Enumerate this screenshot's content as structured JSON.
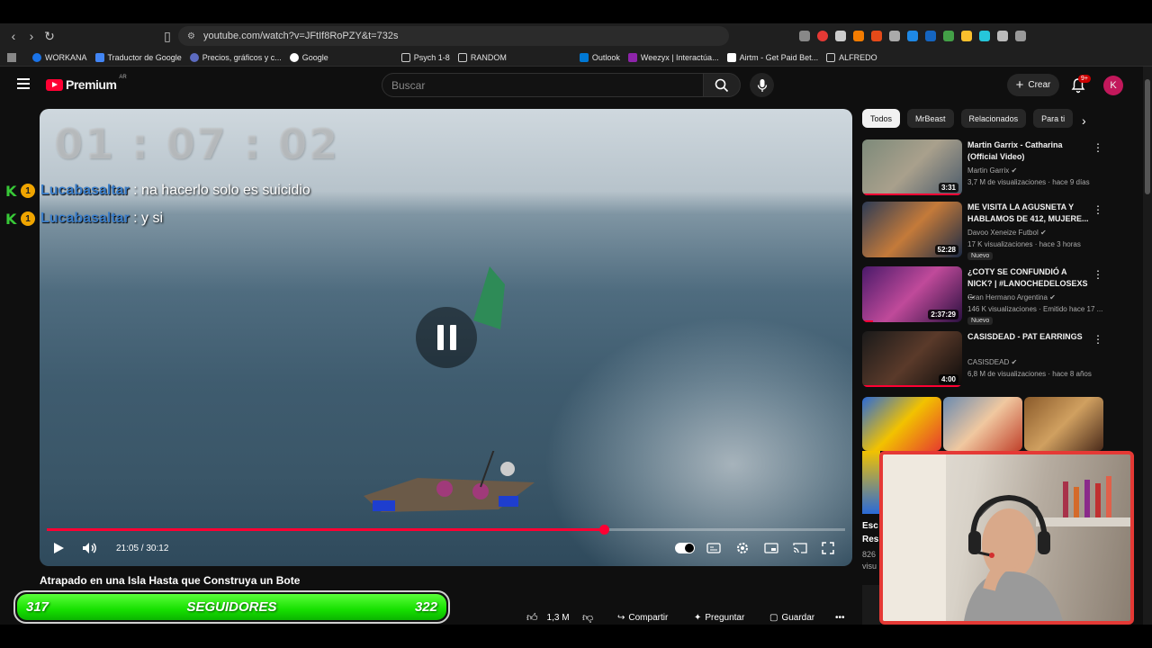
{
  "browser": {
    "url": "youtube.com/watch?v=JFtIf8RoPZY&t=732s",
    "bookmarks": [
      "WORKANA",
      "Traductor de Google",
      "Precios, gráficos y c...",
      "Google",
      "Psych 1-8",
      "RANDOM",
      "Outlook",
      "Weezyx | Interactúa...",
      "Airtm - Get Paid Bet...",
      "ALFREDO"
    ]
  },
  "header": {
    "logo": "Premium",
    "region": "AR",
    "search_placeholder": "Buscar",
    "create_label": "Crear",
    "notif_count": "9+",
    "avatar_letter": "K"
  },
  "player": {
    "overlay_timer": "01 : 07 : 02",
    "chat": [
      {
        "user": "Lucabasaltar",
        "message": " : na hacerlo solo es suicidio"
      },
      {
        "user": "Lucabasaltar",
        "message": " : y si"
      }
    ],
    "time_display": "21:05 / 30:12",
    "progress_fraction": 0.698
  },
  "video": {
    "title": "Atrapado en una Isla Hasta que Construya un Bote",
    "likes": "1,3 M",
    "share_label": "Compartir",
    "ask_label": "Preguntar",
    "save_label": "Guardar"
  },
  "followers": {
    "current": "317",
    "label": "SEGUIDORES",
    "goal": "322"
  },
  "sidebar": {
    "chips": [
      "Todos",
      "MrBeast",
      "Relacionados",
      "Para ti"
    ],
    "recs": [
      {
        "title": "Martin Garrix - Catharina (Official Video)",
        "channel": "Martin Garrix",
        "meta": "3,7 M de visualizaciones · hace 9 días",
        "duration": "3:31",
        "badge": ""
      },
      {
        "title": "ME VISITA LA AGUSNETA Y HABLAMOS DE 412, MUJERE...",
        "channel": "Davoo Xeneize Futbol",
        "meta": "17 K visualizaciones · hace 3 horas",
        "duration": "52:28",
        "badge": "Nuevo"
      },
      {
        "title": "¿COTY SE CONFUNDIÓ A NICK? | #LANOCHEDELOSEXS ...",
        "channel": "Gran Hermano Argentina",
        "meta": "146 K visualizaciones · Emitido hace 17 ...",
        "duration": "2:37:29",
        "badge": "Nuevo"
      },
      {
        "title": "CASISDEAD - PAT EARRINGS",
        "channel": "CASISDEAD",
        "meta": "6,8 M de visualizaciones · hace 8 años",
        "duration": "4:00",
        "badge": ""
      }
    ],
    "cut_text": [
      "Esc",
      "Res",
      "826",
      "visu"
    ]
  },
  "colors": {
    "accent": "#ff0033",
    "followers_green": "#16e000",
    "webcam_border": "#e53935"
  }
}
